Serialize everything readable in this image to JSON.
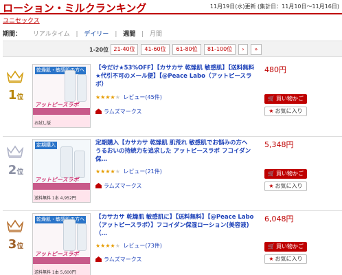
{
  "header": {
    "title": "ローション・ミルクランキング",
    "updated": "11月19日(水)更新 (集計日：11月10日～11月16日)",
    "gender": "ユニセックス"
  },
  "period": {
    "label": "期間：",
    "options": [
      "リアルタイム",
      "デイリー",
      "週間",
      "月間"
    ],
    "active": "週間"
  },
  "pager": {
    "current": "1-20位",
    "pages": [
      "21-40位",
      "41-60位",
      "61-80位",
      "81-100位"
    ],
    "next": "›",
    "last": "»"
  },
  "items": [
    {
      "rank": "1",
      "rank_unit": "位",
      "crown_color": "#d4a017",
      "name": "【今だけ★53%OFF】【カサカサ 乾燥肌 敏感肌】【送料無料★代引不可のメール便】【@Peace Labo（アットピースラボ）",
      "rating": 4,
      "reviews": "レビュー(45件)",
      "shop": "ラムズマークス",
      "price": "480円",
      "buy_label": "買い物かご",
      "fav_label": "お気に入り",
      "thumb_tag": "乾燥肌・敏感肌の方へ",
      "thumb_brand": "アットピースラボ",
      "thumb_caption": "お試し版"
    },
    {
      "rank": "2",
      "rank_unit": "位",
      "crown_color": "#b0b4c8",
      "name": "定期購入【カサカサ 乾燥肌 肌荒れ 敏感肌でお悩みの方へ うるおいの持続力を追求した アットピースラボ フコイダン保…",
      "rating": 4,
      "reviews": "レビュー(21件)",
      "shop": "ラムズマークス",
      "price": "5,348円",
      "buy_label": "買い物かご",
      "fav_label": "お気に入り",
      "thumb_tag": "定期購入",
      "thumb_brand": "アットピースラボ",
      "thumb_caption": "送料無料 1本 4,952円"
    },
    {
      "rank": "3",
      "rank_unit": "位",
      "crown_color": "#b87333",
      "name": "【カサカサ 乾燥肌 敏感肌に】【送料無料】【@Peace Labo（アットピースラボ）】フコイダン保湿ローション(美容液)（…",
      "rating": 4,
      "reviews": "レビュー(73件)",
      "shop": "ラムズマークス",
      "price": "6,048円",
      "buy_label": "買い物かご",
      "fav_label": "お気に入り",
      "thumb_tag": "乾燥肌・敏感肌の方へ",
      "thumb_brand": "アットピースラボ",
      "thumb_caption": "送料無料 1本 5,600円"
    }
  ]
}
